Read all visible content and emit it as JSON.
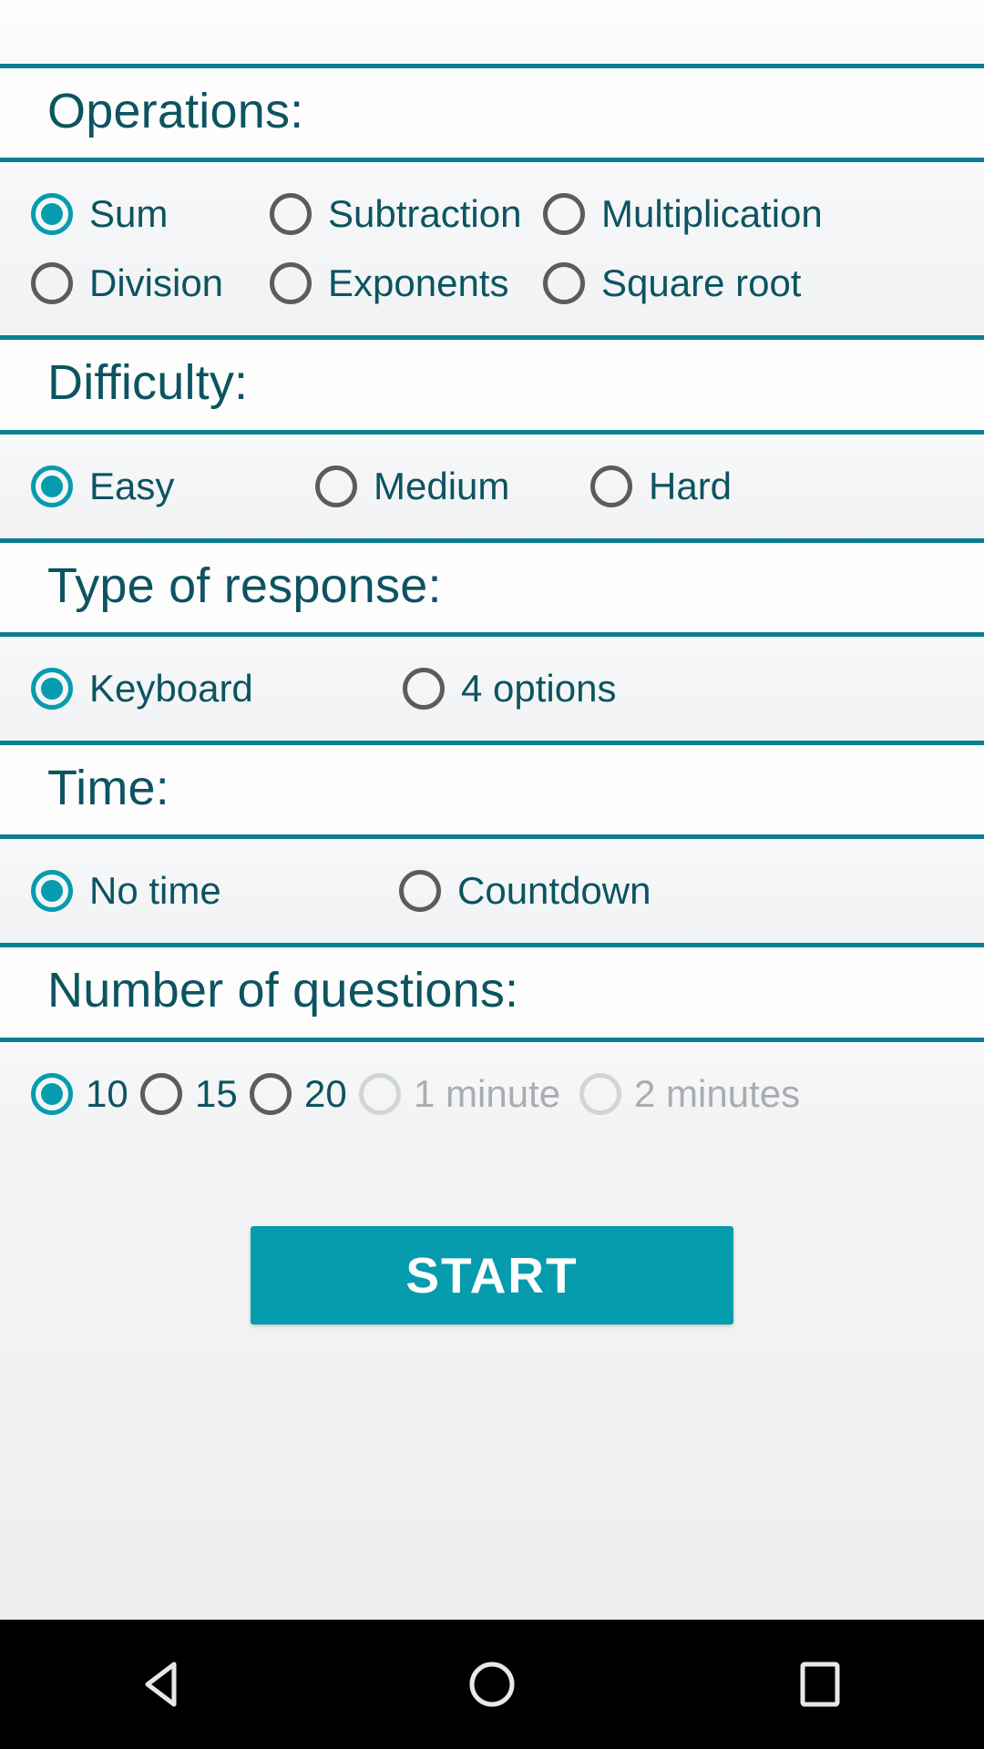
{
  "app": {
    "accent_color": "#069cae",
    "header_text_color": "#0c5460",
    "divider_color": "#0b7f91",
    "disabled_color": "#a9adb0"
  },
  "sections": [
    {
      "id": "operations",
      "title": "Operations:",
      "rows": [
        [
          {
            "label": "Sum",
            "selected": true,
            "disabled": false
          },
          {
            "label": "Subtraction",
            "selected": false,
            "disabled": false
          },
          {
            "label": "Multiplication",
            "selected": false,
            "disabled": false
          }
        ],
        [
          {
            "label": "Division",
            "selected": false,
            "disabled": false
          },
          {
            "label": "Exponents",
            "selected": false,
            "disabled": false
          },
          {
            "label": "Square root",
            "selected": false,
            "disabled": false
          }
        ]
      ]
    },
    {
      "id": "difficulty",
      "title": "Difficulty:",
      "rows": [
        [
          {
            "label": "Easy",
            "selected": true,
            "disabled": false
          },
          {
            "label": "Medium",
            "selected": false,
            "disabled": false
          },
          {
            "label": "Hard",
            "selected": false,
            "disabled": false
          }
        ]
      ]
    },
    {
      "id": "type-of-response",
      "title": "Type of response:",
      "rows": [
        [
          {
            "label": "Keyboard",
            "selected": true,
            "disabled": false
          },
          {
            "label": "4 options",
            "selected": false,
            "disabled": false
          }
        ]
      ]
    },
    {
      "id": "time",
      "title": "Time:",
      "rows": [
        [
          {
            "label": "No time",
            "selected": true,
            "disabled": false
          },
          {
            "label": "Countdown",
            "selected": false,
            "disabled": false
          }
        ]
      ]
    },
    {
      "id": "number-of-questions",
      "title": "Number of questions:",
      "rows": [
        [
          {
            "label": "10",
            "selected": true,
            "disabled": false
          },
          {
            "label": "15",
            "selected": false,
            "disabled": false
          },
          {
            "label": "20",
            "selected": false,
            "disabled": false
          },
          {
            "label": "1 minute",
            "selected": false,
            "disabled": true
          },
          {
            "label": "2 minutes",
            "selected": false,
            "disabled": true
          }
        ]
      ]
    }
  ],
  "start_button": {
    "label": "START"
  },
  "navbar": {
    "back_icon": "triangle-back-icon",
    "home_icon": "circle-home-icon",
    "recents_icon": "square-recents-icon"
  }
}
